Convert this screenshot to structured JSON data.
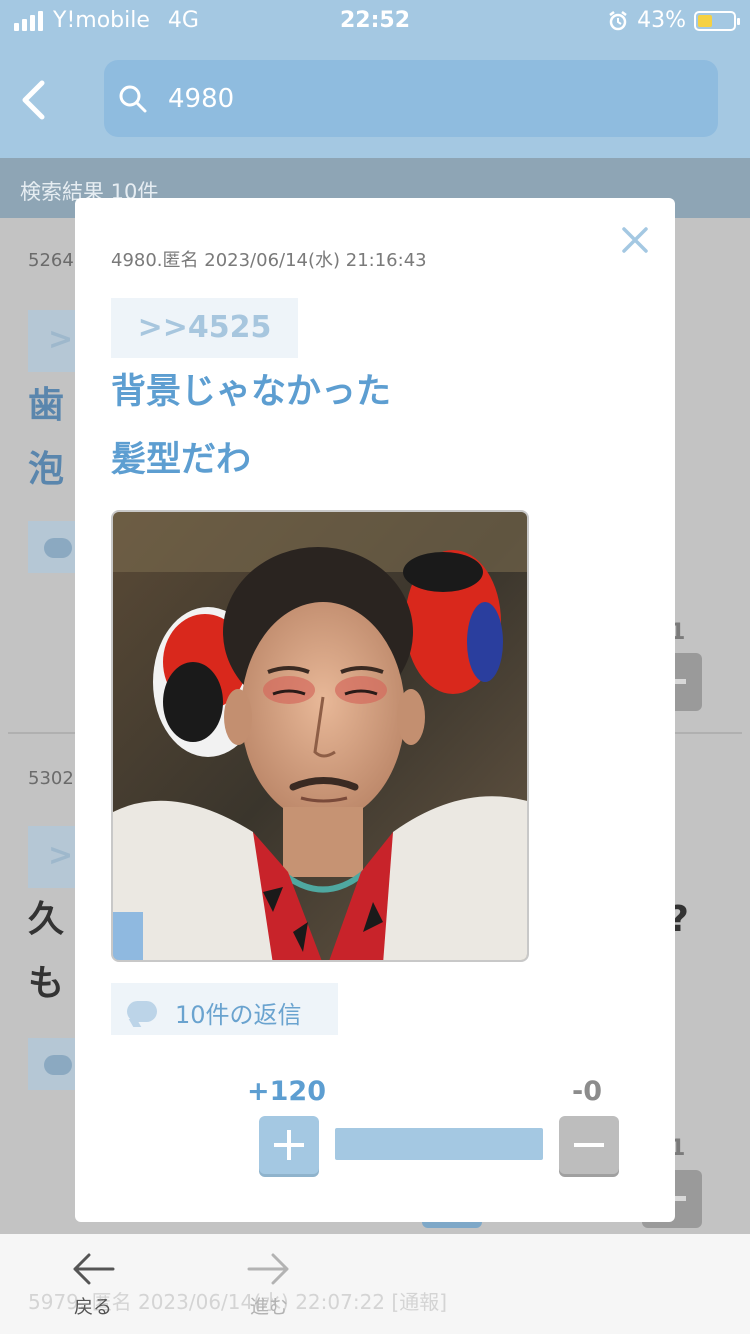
{
  "status": {
    "carrier": "Y!mobile",
    "network": "4G",
    "time": "22:52",
    "battery": "43%"
  },
  "header": {
    "search_query": "4980"
  },
  "results_label": "検索結果 10件",
  "background_posts": [
    {
      "num": "5264",
      "anchor": ">",
      "line1": "歯",
      "line2": "泡",
      "count": "1"
    },
    {
      "num": "5302",
      "anchor": ">",
      "line1": "久",
      "line2": "も",
      "trailing": "?",
      "count": "1"
    }
  ],
  "behind_footer_text": "5979. 匿名 2023/06/14(水) 22:07:22 [通報]",
  "modal": {
    "meta": "4980.匿名 2023/06/14(水) 21:16:43",
    "anchor": ">>4525",
    "line1": "背景じゃなかった",
    "line2": "髪型だわ",
    "reply_label": "10件の返信",
    "plus_votes": "+120",
    "minus_votes": "-0",
    "plus_ratio": 1.0
  },
  "nav": {
    "back_label": "戻る",
    "forward_label": "進む"
  },
  "colors": {
    "accent": "#5d9ed1",
    "header_bg": "#a4c8e2",
    "overlay": "#c3c3c3"
  }
}
